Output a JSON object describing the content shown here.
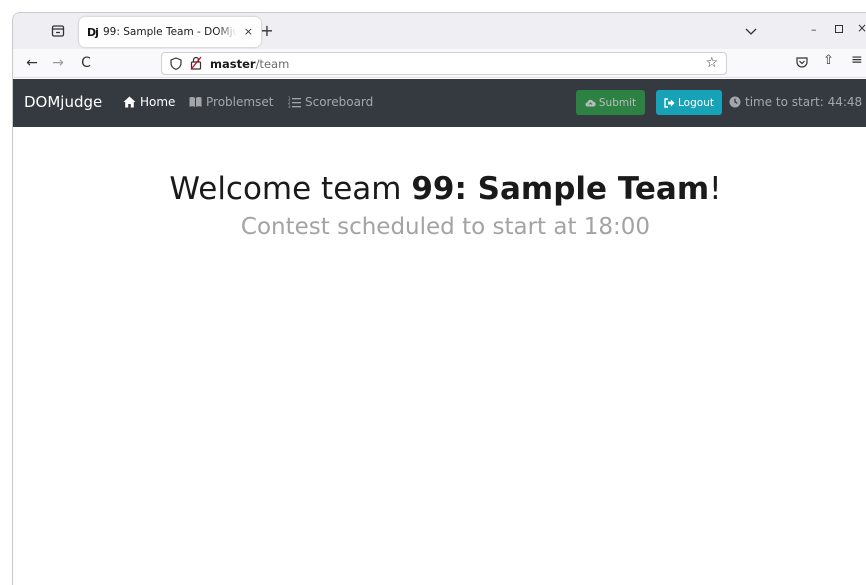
{
  "browser": {
    "tab_favicon": "Dj",
    "tab_title": "99: Sample Team - DOMjudge",
    "tab_close": "×",
    "new_tab": "+",
    "url_host": "master",
    "url_path": "/team",
    "back": "←",
    "forward": "→",
    "reload": "C",
    "bookmark_star": "☆",
    "share": "⇧",
    "menu": "≡",
    "window_minimize": "–",
    "window_close": "×"
  },
  "navbar": {
    "brand": "DOMjudge",
    "home": "Home",
    "problemset": "Problemset",
    "scoreboard": "Scoreboard",
    "submit": "Submit",
    "logout": "Logout",
    "timer": "time to start: 44:48"
  },
  "main": {
    "welcome_prefix": "Welcome team ",
    "team_name": "99: Sample Team",
    "welcome_suffix": "!",
    "scheduled": "Contest scheduled to start at 18:00"
  },
  "colors": {
    "navbar_bg": "#343a40",
    "submit_bg": "#28a745",
    "logout_bg": "#17a2b8"
  },
  "icons": [
    "tab-overview-icon",
    "shield-icon",
    "lock-icon",
    "star-icon",
    "pocket-icon",
    "share-icon",
    "menu-icon",
    "home-icon",
    "book-icon",
    "list-icon",
    "cloud-upload-icon",
    "sign-out-icon",
    "clock-icon"
  ]
}
